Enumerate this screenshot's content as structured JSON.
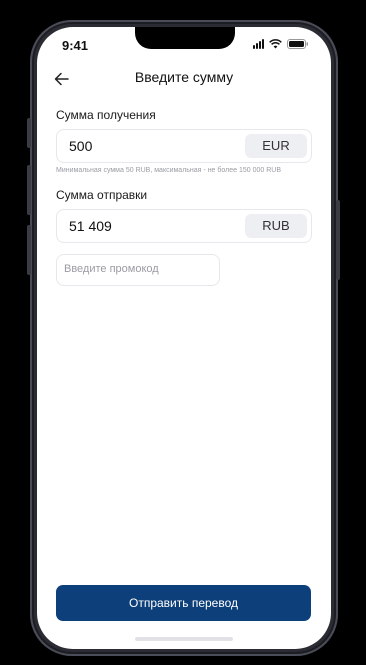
{
  "status_bar": {
    "time": "9:41"
  },
  "header": {
    "title": "Введите сумму"
  },
  "receive": {
    "label": "Сумма получения",
    "amount": "500",
    "currency": "EUR",
    "hint": "Минимальная сумма 50 RUB, максимальная - не более 150 000 RUB"
  },
  "send": {
    "label": "Сумма отправки",
    "amount": "51 409",
    "currency": "RUB"
  },
  "promo": {
    "placeholder": "Введите промокод",
    "value": ""
  },
  "submit": {
    "label": "Отправить перевод"
  },
  "colors": {
    "accent": "#0d3f7a",
    "chip": "#eeeff2",
    "border": "#e6e7ea"
  },
  "icons": {
    "back": "arrow-left-icon",
    "signal": "signal-icon",
    "wifi": "wifi-icon",
    "battery": "battery-icon"
  }
}
